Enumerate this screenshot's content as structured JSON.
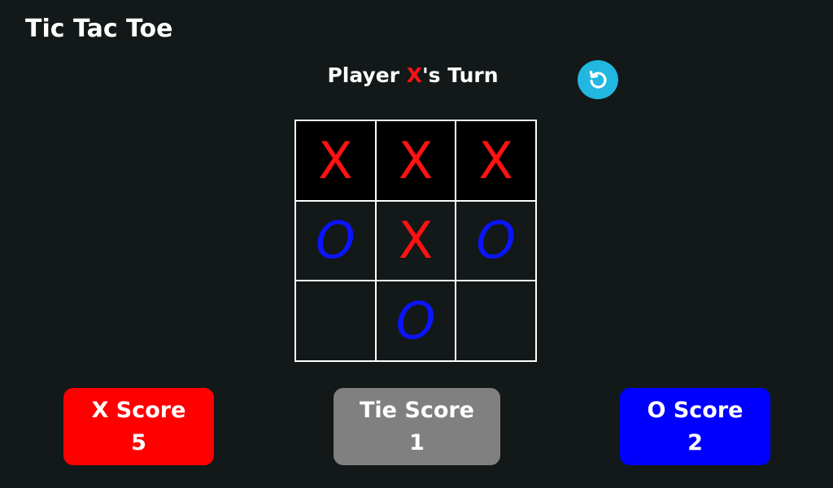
{
  "app": {
    "title": "Tic Tac Toe"
  },
  "status": {
    "prefix": "Player ",
    "player": "X",
    "suffix": "'s Turn"
  },
  "reset": {
    "icon": "reset-icon"
  },
  "board": {
    "cells": [
      "X",
      "X",
      "X",
      "O",
      "X",
      "O",
      "",
      "O",
      ""
    ],
    "winning_cells": [
      0,
      1,
      2
    ]
  },
  "scores": {
    "x": {
      "label": "X Score",
      "value": "5"
    },
    "tie": {
      "label": "Tie Score",
      "value": "1"
    },
    "o": {
      "label": "O Score",
      "value": "2"
    }
  },
  "colors": {
    "background": "#131819",
    "x": "#ff1212",
    "o": "#0a14ff",
    "reset": "#22b7e0",
    "x_score_bg": "#ff0000",
    "tie_score_bg": "#808080",
    "o_score_bg": "#0000ff"
  }
}
